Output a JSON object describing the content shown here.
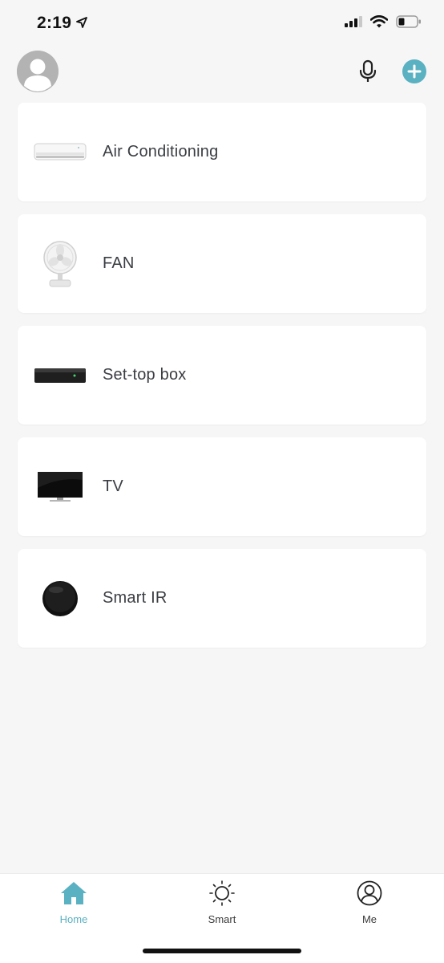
{
  "status_bar": {
    "time": "2:19"
  },
  "header": {
    "avatar_icon": "user-avatar-icon",
    "mic_icon": "microphone-icon",
    "add_icon": "plus-icon",
    "accent_color": "#5ab1c1"
  },
  "devices": [
    {
      "name": "Air Conditioning",
      "icon": "air-conditioner-icon"
    },
    {
      "name": "FAN",
      "icon": "fan-icon"
    },
    {
      "name": "Set-top box",
      "icon": "set-top-box-icon"
    },
    {
      "name": "TV",
      "icon": "tv-icon"
    },
    {
      "name": "Smart IR",
      "icon": "smart-ir-icon"
    }
  ],
  "tabs": [
    {
      "label": "Home",
      "icon": "home-icon",
      "active": true
    },
    {
      "label": "Smart",
      "icon": "sun-icon",
      "active": false
    },
    {
      "label": "Me",
      "icon": "user-circle-icon",
      "active": false
    }
  ]
}
